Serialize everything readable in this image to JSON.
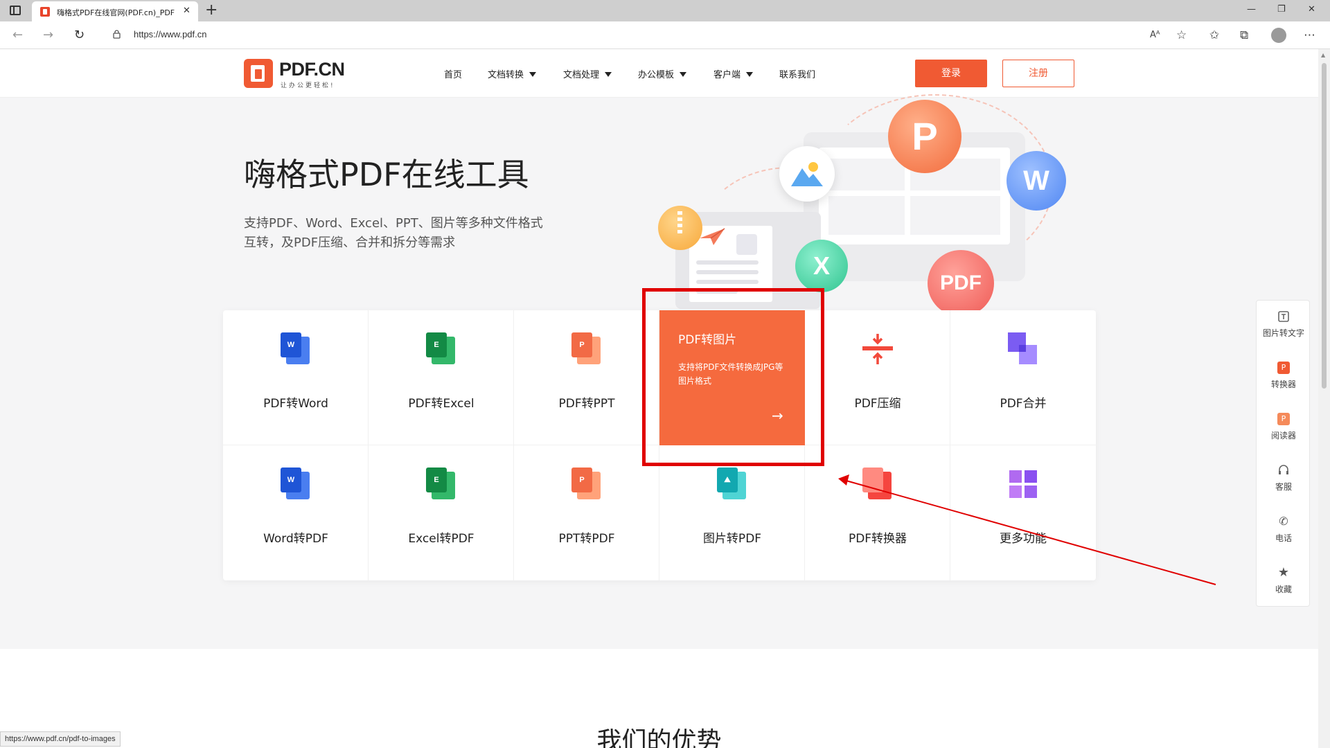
{
  "browser": {
    "tab_title": "嗨格式PDF在线官网(PDF.cn)_PDF",
    "url": "https://www.pdf.cn",
    "status_url": "https://www.pdf.cn/pdf-to-images"
  },
  "site": {
    "logo_text": "PDF.CN",
    "logo_sub": "让办公更轻松!",
    "nav": [
      {
        "label": "首页",
        "dropdown": false
      },
      {
        "label": "文档转换",
        "dropdown": true
      },
      {
        "label": "文档处理",
        "dropdown": true
      },
      {
        "label": "办公模板",
        "dropdown": true
      },
      {
        "label": "客户端",
        "dropdown": true
      },
      {
        "label": "联系我们",
        "dropdown": false
      }
    ],
    "login_label": "登录",
    "register_label": "注册"
  },
  "hero": {
    "title": "嗨格式PDF在线工具",
    "desc_line1": "支持PDF、Word、Excel、PPT、图片等多种文件格式",
    "desc_line2": "互转，及PDF压缩、合并和拆分等需求",
    "bubbles": [
      "P",
      "W",
      "X",
      "PDF"
    ]
  },
  "tools": {
    "row1": [
      {
        "label": "PDF转Word",
        "icon": "word-file-icon",
        "letter": "W"
      },
      {
        "label": "PDF转Excel",
        "icon": "excel-file-icon",
        "letter": "E"
      },
      {
        "label": "PDF转PPT",
        "icon": "ppt-file-icon",
        "letter": "P"
      },
      {
        "label": "PDF转图片",
        "featured": true
      },
      {
        "label": "PDF压缩",
        "icon": "compress-icon"
      },
      {
        "label": "PDF合并",
        "icon": "merge-icon"
      }
    ],
    "row2": [
      {
        "label": "Word转PDF",
        "icon": "word-file-icon",
        "letter": "W"
      },
      {
        "label": "Excel转PDF",
        "icon": "excel-file-icon",
        "letter": "E"
      },
      {
        "label": "PPT转PDF",
        "icon": "ppt-file-icon",
        "letter": "P"
      },
      {
        "label": "图片转PDF",
        "icon": "image-file-icon"
      },
      {
        "label": "PDF转换器",
        "icon": "pdf-converter-icon"
      },
      {
        "label": "更多功能",
        "icon": "more-grid-icon"
      }
    ],
    "featured": {
      "title": "PDF转图片",
      "desc": "支持将PDF文件转换成JPG等图片格式",
      "arrow": "→"
    }
  },
  "float_bar": [
    {
      "label": "图片转文字",
      "icon": "image-to-text-icon"
    },
    {
      "label": "转换器",
      "icon": "converter-icon"
    },
    {
      "label": "阅读器",
      "icon": "reader-icon"
    },
    {
      "label": "客服",
      "icon": "headset-icon"
    },
    {
      "label": "电话",
      "icon": "phone-icon"
    },
    {
      "label": "收藏",
      "icon": "star-icon"
    }
  ],
  "section": {
    "title": "我们的优势"
  },
  "colors": {
    "accent": "#f05a33",
    "featured_bg": "#f56a3e",
    "highlight_box": "#e00000"
  }
}
